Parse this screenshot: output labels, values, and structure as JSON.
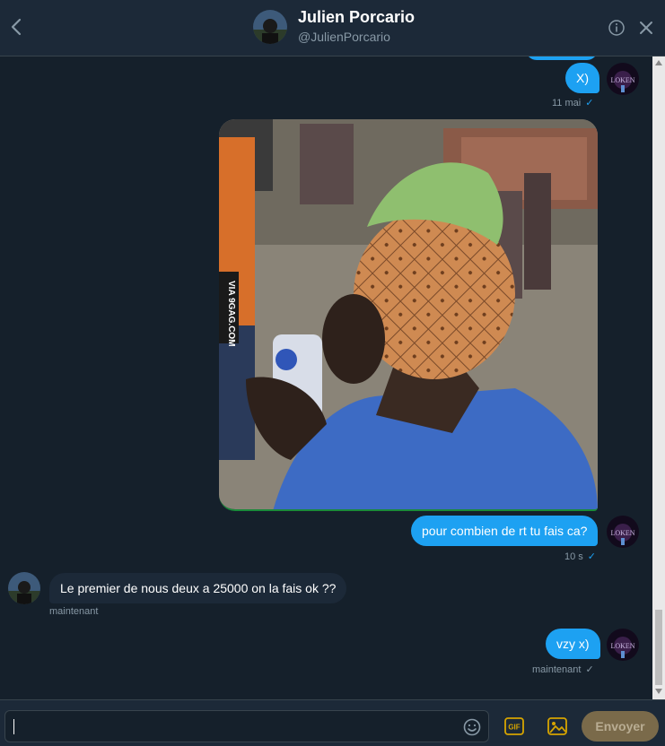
{
  "header": {
    "name": "Julien Porcario",
    "handle": "@JulienPorcario"
  },
  "messages": [
    {
      "direction": "out",
      "text": "X)",
      "timestamp": "11 mai",
      "status": "✓"
    },
    {
      "direction": "out",
      "type": "image",
      "watermark": "VIA 9GAG.COM"
    },
    {
      "direction": "out",
      "text": "pour combien de rt tu fais ca?",
      "timestamp": "10 s",
      "status": "✓"
    },
    {
      "direction": "in",
      "text": "Le premier de nous deux a 25000 on la fais ok ??",
      "timestamp": "maintenant"
    },
    {
      "direction": "out",
      "text": "vzy x)",
      "timestamp": "maintenant",
      "status": "✓"
    }
  ],
  "composer": {
    "input_value": "",
    "gif_label": "GIF",
    "send_label": "Envoyer"
  },
  "colors": {
    "background": "#15202b",
    "panel": "#1c2938",
    "accent": "#1da1f2",
    "muted_text": "#8899a6",
    "send_disabled": "#7a6a4a"
  }
}
